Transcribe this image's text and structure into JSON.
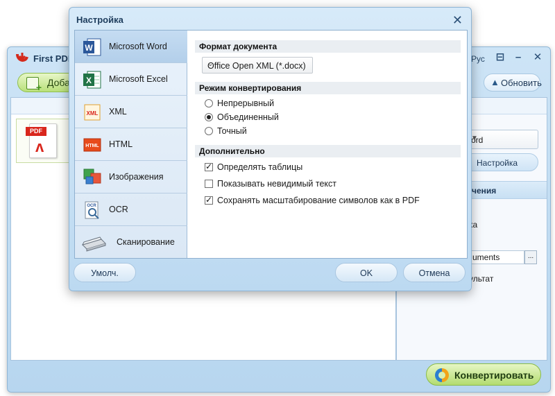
{
  "main_window": {
    "title": "First PDF",
    "language": "Рус",
    "add_button_label": "Доба",
    "refresh_button_label": "Обновить",
    "file_tag": "PDF",
    "format_select_value": "ord",
    "settings_button_label": "Настройка",
    "save_section_header": "чения",
    "right_text1": "ка",
    "output_path": "uments",
    "browse_label": "...",
    "right_text2": "ультат",
    "convert_button_label": "Конвертировать"
  },
  "dialog": {
    "title": "Настройка",
    "menu": [
      {
        "label": "Microsoft Word"
      },
      {
        "label": "Microsoft Excel"
      },
      {
        "label": "XML"
      },
      {
        "label": "HTML"
      },
      {
        "label": "Изображения"
      },
      {
        "label": "OCR"
      },
      {
        "label": "Сканирование"
      }
    ],
    "active_menu_index": 0,
    "format_section": {
      "title": "Формат документа",
      "selected": "Office Open XML (*.docx)"
    },
    "mode_section": {
      "title": "Режим конвертирования",
      "options": [
        "Непрерывный",
        "Объединенный",
        "Точный"
      ],
      "selected_index": 1
    },
    "extra_section": {
      "title": "Дополнительно",
      "options": [
        {
          "label": "Определять таблицы",
          "checked": true
        },
        {
          "label": "Показывать невидимый текст",
          "checked": false
        },
        {
          "label": "Сохранять масштабирование символов как в PDF",
          "checked": true
        }
      ]
    },
    "buttons": {
      "defaults": "Умолч.",
      "ok": "OK",
      "cancel": "Отмена"
    },
    "icon_texts": {
      "xml": "XML",
      "html": "HTML",
      "ocr": "OCR"
    }
  }
}
